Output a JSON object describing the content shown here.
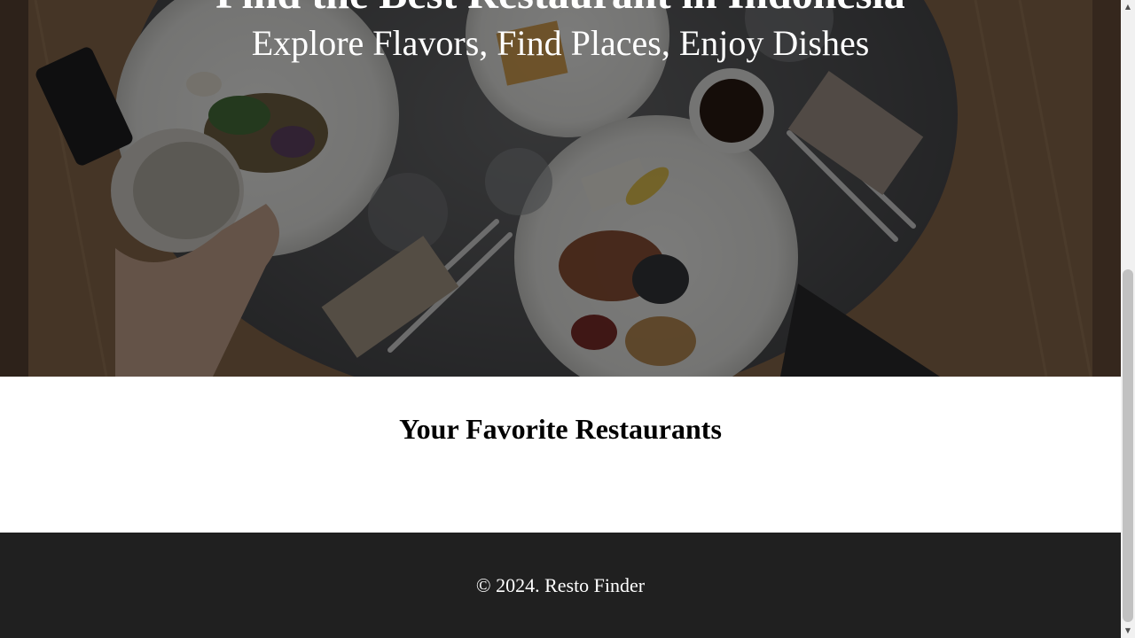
{
  "hero": {
    "title": "Find the Best Restaurant in Indonesia",
    "subtitle": "Explore Flavors, Find Places, Enjoy Dishes"
  },
  "favorites": {
    "heading": "Your Favorite Restaurants"
  },
  "footer": {
    "copyright": "© 2024. Resto Finder"
  },
  "colors": {
    "footer_bg": "#202020",
    "page_bg": "#ffffff",
    "hero_overlay": "#000000"
  },
  "icons": {
    "scroll_up": "triangle-up-icon",
    "scroll_down": "triangle-down-icon"
  }
}
